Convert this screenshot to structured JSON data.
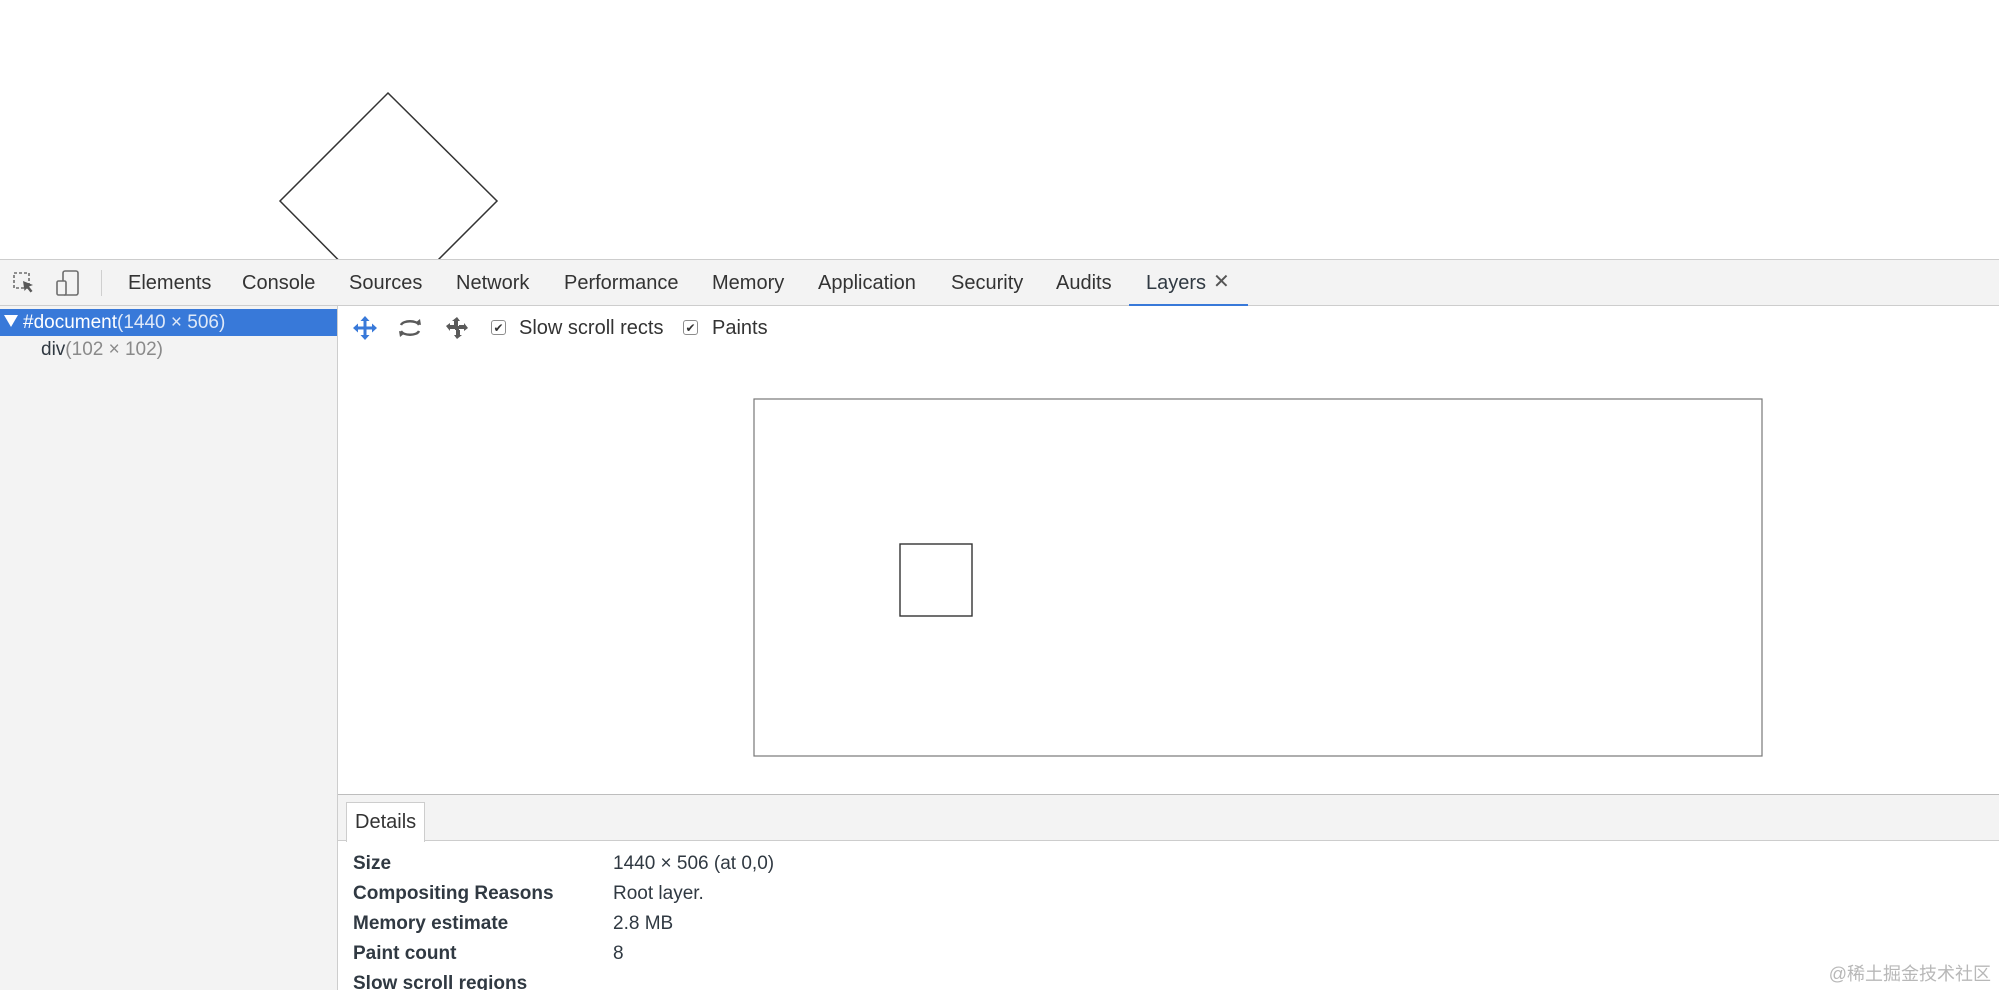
{
  "devtools": {
    "tabs": [
      "Elements",
      "Console",
      "Sources",
      "Network",
      "Performance",
      "Memory",
      "Application",
      "Security",
      "Audits",
      "Layers"
    ],
    "active_tab": "Layers",
    "close_glyph": "✕",
    "icons": {
      "inspect": "inspect-element-icon",
      "device": "device-toolbar-icon"
    }
  },
  "layer_tree": {
    "items": [
      {
        "name": "#document",
        "size": "(1440 × 506)",
        "selected": true
      },
      {
        "name": "div",
        "size": "(102 × 102)",
        "selected": false
      }
    ]
  },
  "layers_toolbar": {
    "icons": [
      "pan-mode-icon",
      "rotate-mode-icon",
      "reset-transform-icon"
    ],
    "slow_scroll_rects": {
      "label": "Slow scroll rects",
      "checked": true
    },
    "paints": {
      "label": "Paints",
      "checked": true
    },
    "check_glyph": "✔"
  },
  "details": {
    "tab_label": "Details",
    "rows": [
      {
        "name": "Size",
        "value": "1440 × 506 (at 0,0)"
      },
      {
        "name": "Compositing Reasons",
        "value": "Root layer."
      },
      {
        "name": "Memory estimate",
        "value": "2.8 MB"
      },
      {
        "name": "Paint count",
        "value": "8"
      },
      {
        "name": "Slow scroll regions",
        "value": ""
      }
    ]
  },
  "watermark": "@稀土掘金技术社区",
  "colors": {
    "accent": "#3879d9",
    "toolbar_bg": "#f3f3f3",
    "border": "#cdcdcd"
  }
}
